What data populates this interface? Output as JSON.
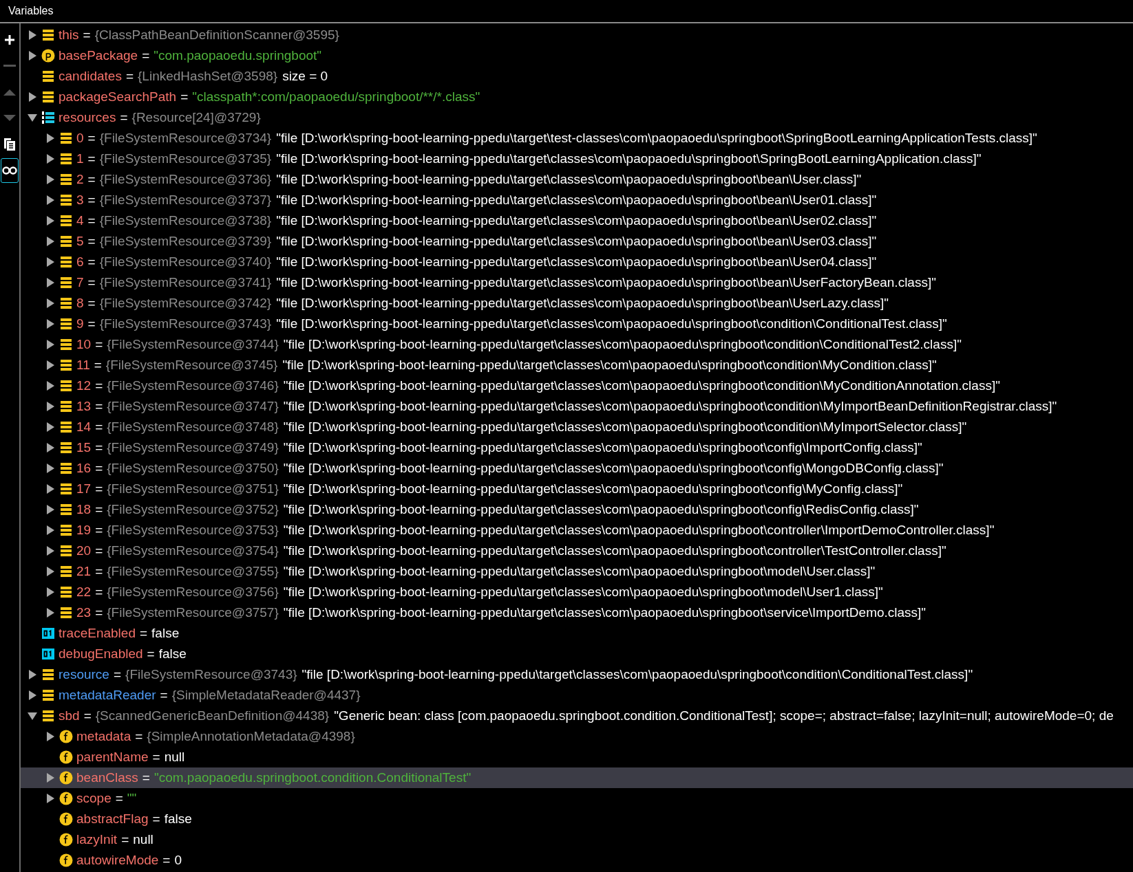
{
  "panel": {
    "title": "Variables"
  },
  "toolbar": [
    {
      "kind": "add",
      "on": false
    },
    {
      "kind": "remove",
      "on": false
    },
    {
      "kind": "up",
      "on": false
    },
    {
      "kind": "down",
      "on": false
    },
    {
      "kind": "copy",
      "on": false
    },
    {
      "kind": "watch",
      "on": true
    }
  ],
  "variables": [
    {
      "name": "this",
      "color": "#f4726a",
      "kind": "object",
      "expanded": false,
      "selected": false,
      "eq": "=",
      "value": [
        {
          "kind": "ref",
          "text": "{ClassPathBeanDefinitionScanner@3595}"
        }
      ]
    },
    {
      "name": "basePackage",
      "color": "#f4726a",
      "kind": "param",
      "expanded": false,
      "selected": false,
      "eq": "=",
      "value": [
        {
          "kind": "string",
          "text": "\"com.paopaoedu.springboot\""
        }
      ]
    },
    {
      "name": "candidates",
      "color": "#f4726a",
      "kind": "object",
      "selected": false,
      "eq": "=",
      "value": [
        {
          "kind": "ref",
          "text": "{LinkedHashSet@3598}"
        },
        {
          "kind": "text",
          "text": "size = 0"
        }
      ]
    },
    {
      "name": "packageSearchPath",
      "color": "#f4726a",
      "kind": "object",
      "expanded": false,
      "selected": false,
      "eq": "=",
      "value": [
        {
          "kind": "string",
          "text": "\"classpath*:com/paopaoedu/springboot/**/*.class\""
        }
      ]
    },
    {
      "name": "resources",
      "color": "#f4726a",
      "kind": "array",
      "expanded": true,
      "selected": false,
      "eq": "=",
      "value": [
        {
          "kind": "ref",
          "text": "{Resource[24]@3729}"
        }
      ],
      "children": [
        {
          "name": "0",
          "color": "#f4726a",
          "kind": "object",
          "expanded": false,
          "selected": false,
          "eq": "=",
          "value": [
            {
              "kind": "ref",
              "text": "{FileSystemResource@3734}"
            },
            {
              "kind": "text",
              "text": "\"file [D:\\work\\spring-boot-learning-ppedu\\target\\test-classes\\com\\paopaoedu\\springboot\\SpringBootLearningApplicationTests.class]\""
            }
          ]
        },
        {
          "name": "1",
          "color": "#f4726a",
          "kind": "object",
          "expanded": false,
          "selected": false,
          "eq": "=",
          "value": [
            {
              "kind": "ref",
              "text": "{FileSystemResource@3735}"
            },
            {
              "kind": "text",
              "text": "\"file [D:\\work\\spring-boot-learning-ppedu\\target\\classes\\com\\paopaoedu\\springboot\\SpringBootLearningApplication.class]\""
            }
          ]
        },
        {
          "name": "2",
          "color": "#f4726a",
          "kind": "object",
          "expanded": false,
          "selected": false,
          "eq": "=",
          "value": [
            {
              "kind": "ref",
              "text": "{FileSystemResource@3736}"
            },
            {
              "kind": "text",
              "text": "\"file [D:\\work\\spring-boot-learning-ppedu\\target\\classes\\com\\paopaoedu\\springboot\\bean\\User.class]\""
            }
          ]
        },
        {
          "name": "3",
          "color": "#f4726a",
          "kind": "object",
          "expanded": false,
          "selected": false,
          "eq": "=",
          "value": [
            {
              "kind": "ref",
              "text": "{FileSystemResource@3737}"
            },
            {
              "kind": "text",
              "text": "\"file [D:\\work\\spring-boot-learning-ppedu\\target\\classes\\com\\paopaoedu\\springboot\\bean\\User01.class]\""
            }
          ]
        },
        {
          "name": "4",
          "color": "#f4726a",
          "kind": "object",
          "expanded": false,
          "selected": false,
          "eq": "=",
          "value": [
            {
              "kind": "ref",
              "text": "{FileSystemResource@3738}"
            },
            {
              "kind": "text",
              "text": "\"file [D:\\work\\spring-boot-learning-ppedu\\target\\classes\\com\\paopaoedu\\springboot\\bean\\User02.class]\""
            }
          ]
        },
        {
          "name": "5",
          "color": "#f4726a",
          "kind": "object",
          "expanded": false,
          "selected": false,
          "eq": "=",
          "value": [
            {
              "kind": "ref",
              "text": "{FileSystemResource@3739}"
            },
            {
              "kind": "text",
              "text": "\"file [D:\\work\\spring-boot-learning-ppedu\\target\\classes\\com\\paopaoedu\\springboot\\bean\\User03.class]\""
            }
          ]
        },
        {
          "name": "6",
          "color": "#f4726a",
          "kind": "object",
          "expanded": false,
          "selected": false,
          "eq": "=",
          "value": [
            {
              "kind": "ref",
              "text": "{FileSystemResource@3740}"
            },
            {
              "kind": "text",
              "text": "\"file [D:\\work\\spring-boot-learning-ppedu\\target\\classes\\com\\paopaoedu\\springboot\\bean\\User04.class]\""
            }
          ]
        },
        {
          "name": "7",
          "color": "#f4726a",
          "kind": "object",
          "expanded": false,
          "selected": false,
          "eq": "=",
          "value": [
            {
              "kind": "ref",
              "text": "{FileSystemResource@3741}"
            },
            {
              "kind": "text",
              "text": "\"file [D:\\work\\spring-boot-learning-ppedu\\target\\classes\\com\\paopaoedu\\springboot\\bean\\UserFactoryBean.class]\""
            }
          ]
        },
        {
          "name": "8",
          "color": "#f4726a",
          "kind": "object",
          "expanded": false,
          "selected": false,
          "eq": "=",
          "value": [
            {
              "kind": "ref",
              "text": "{FileSystemResource@3742}"
            },
            {
              "kind": "text",
              "text": "\"file [D:\\work\\spring-boot-learning-ppedu\\target\\classes\\com\\paopaoedu\\springboot\\bean\\UserLazy.class]\""
            }
          ]
        },
        {
          "name": "9",
          "color": "#f4726a",
          "kind": "object",
          "expanded": false,
          "selected": false,
          "eq": "=",
          "value": [
            {
              "kind": "ref",
              "text": "{FileSystemResource@3743}"
            },
            {
              "kind": "text",
              "text": "\"file [D:\\work\\spring-boot-learning-ppedu\\target\\classes\\com\\paopaoedu\\springboot\\condition\\ConditionalTest.class]\""
            }
          ]
        },
        {
          "name": "10",
          "color": "#f4726a",
          "kind": "object",
          "expanded": false,
          "selected": false,
          "eq": "=",
          "value": [
            {
              "kind": "ref",
              "text": "{FileSystemResource@3744}"
            },
            {
              "kind": "text",
              "text": "\"file [D:\\work\\spring-boot-learning-ppedu\\target\\classes\\com\\paopaoedu\\springboot\\condition\\ConditionalTest2.class]\""
            }
          ]
        },
        {
          "name": "11",
          "color": "#f4726a",
          "kind": "object",
          "expanded": false,
          "selected": false,
          "eq": "=",
          "value": [
            {
              "kind": "ref",
              "text": "{FileSystemResource@3745}"
            },
            {
              "kind": "text",
              "text": "\"file [D:\\work\\spring-boot-learning-ppedu\\target\\classes\\com\\paopaoedu\\springboot\\condition\\MyCondition.class]\""
            }
          ]
        },
        {
          "name": "12",
          "color": "#f4726a",
          "kind": "object",
          "expanded": false,
          "selected": false,
          "eq": "=",
          "value": [
            {
              "kind": "ref",
              "text": "{FileSystemResource@3746}"
            },
            {
              "kind": "text",
              "text": "\"file [D:\\work\\spring-boot-learning-ppedu\\target\\classes\\com\\paopaoedu\\springboot\\condition\\MyConditionAnnotation.class]\""
            }
          ]
        },
        {
          "name": "13",
          "color": "#f4726a",
          "kind": "object",
          "expanded": false,
          "selected": false,
          "eq": "=",
          "value": [
            {
              "kind": "ref",
              "text": "{FileSystemResource@3747}"
            },
            {
              "kind": "text",
              "text": "\"file [D:\\work\\spring-boot-learning-ppedu\\target\\classes\\com\\paopaoedu\\springboot\\condition\\MyImportBeanDefinitionRegistrar.class]\""
            }
          ]
        },
        {
          "name": "14",
          "color": "#f4726a",
          "kind": "object",
          "expanded": false,
          "selected": false,
          "eq": "=",
          "value": [
            {
              "kind": "ref",
              "text": "{FileSystemResource@3748}"
            },
            {
              "kind": "text",
              "text": "\"file [D:\\work\\spring-boot-learning-ppedu\\target\\classes\\com\\paopaoedu\\springboot\\condition\\MyImportSelector.class]\""
            }
          ]
        },
        {
          "name": "15",
          "color": "#f4726a",
          "kind": "object",
          "expanded": false,
          "selected": false,
          "eq": "=",
          "value": [
            {
              "kind": "ref",
              "text": "{FileSystemResource@3749}"
            },
            {
              "kind": "text",
              "text": "\"file [D:\\work\\spring-boot-learning-ppedu\\target\\classes\\com\\paopaoedu\\springboot\\config\\ImportConfig.class]\""
            }
          ]
        },
        {
          "name": "16",
          "color": "#f4726a",
          "kind": "object",
          "expanded": false,
          "selected": false,
          "eq": "=",
          "value": [
            {
              "kind": "ref",
              "text": "{FileSystemResource@3750}"
            },
            {
              "kind": "text",
              "text": "\"file [D:\\work\\spring-boot-learning-ppedu\\target\\classes\\com\\paopaoedu\\springboot\\config\\MongoDBConfig.class]\""
            }
          ]
        },
        {
          "name": "17",
          "color": "#f4726a",
          "kind": "object",
          "expanded": false,
          "selected": false,
          "eq": "=",
          "value": [
            {
              "kind": "ref",
              "text": "{FileSystemResource@3751}"
            },
            {
              "kind": "text",
              "text": "\"file [D:\\work\\spring-boot-learning-ppedu\\target\\classes\\com\\paopaoedu\\springboot\\config\\MyConfig.class]\""
            }
          ]
        },
        {
          "name": "18",
          "color": "#f4726a",
          "kind": "object",
          "expanded": false,
          "selected": false,
          "eq": "=",
          "value": [
            {
              "kind": "ref",
              "text": "{FileSystemResource@3752}"
            },
            {
              "kind": "text",
              "text": "\"file [D:\\work\\spring-boot-learning-ppedu\\target\\classes\\com\\paopaoedu\\springboot\\config\\RedisConfig.class]\""
            }
          ]
        },
        {
          "name": "19",
          "color": "#f4726a",
          "kind": "object",
          "expanded": false,
          "selected": false,
          "eq": "=",
          "value": [
            {
              "kind": "ref",
              "text": "{FileSystemResource@3753}"
            },
            {
              "kind": "text",
              "text": "\"file [D:\\work\\spring-boot-learning-ppedu\\target\\classes\\com\\paopaoedu\\springboot\\controller\\ImportDemoController.class]\""
            }
          ]
        },
        {
          "name": "20",
          "color": "#f4726a",
          "kind": "object",
          "expanded": false,
          "selected": false,
          "eq": "=",
          "value": [
            {
              "kind": "ref",
              "text": "{FileSystemResource@3754}"
            },
            {
              "kind": "text",
              "text": "\"file [D:\\work\\spring-boot-learning-ppedu\\target\\classes\\com\\paopaoedu\\springboot\\controller\\TestController.class]\""
            }
          ]
        },
        {
          "name": "21",
          "color": "#f4726a",
          "kind": "object",
          "expanded": false,
          "selected": false,
          "eq": "=",
          "value": [
            {
              "kind": "ref",
              "text": "{FileSystemResource@3755}"
            },
            {
              "kind": "text",
              "text": "\"file [D:\\work\\spring-boot-learning-ppedu\\target\\classes\\com\\paopaoedu\\springboot\\model\\User.class]\""
            }
          ]
        },
        {
          "name": "22",
          "color": "#f4726a",
          "kind": "object",
          "expanded": false,
          "selected": false,
          "eq": "=",
          "value": [
            {
              "kind": "ref",
              "text": "{FileSystemResource@3756}"
            },
            {
              "kind": "text",
              "text": "\"file [D:\\work\\spring-boot-learning-ppedu\\target\\classes\\com\\paopaoedu\\springboot\\model\\User1.class]\""
            }
          ]
        },
        {
          "name": "23",
          "color": "#f4726a",
          "kind": "object",
          "expanded": false,
          "selected": false,
          "eq": "=",
          "value": [
            {
              "kind": "ref",
              "text": "{FileSystemResource@3757}"
            },
            {
              "kind": "text",
              "text": "\"file [D:\\work\\spring-boot-learning-ppedu\\target\\classes\\com\\paopaoedu\\springboot\\service\\ImportDemo.class]\""
            }
          ]
        }
      ]
    },
    {
      "name": "traceEnabled",
      "color": "#f4726a",
      "kind": "primitive",
      "selected": false,
      "eq": "=",
      "value": [
        {
          "kind": "text",
          "text": "false"
        }
      ]
    },
    {
      "name": "debugEnabled",
      "color": "#f4726a",
      "kind": "primitive",
      "selected": false,
      "eq": "=",
      "value": [
        {
          "kind": "text",
          "text": "false"
        }
      ]
    },
    {
      "name": "resource",
      "color": "#4f9cf5",
      "kind": "object",
      "expanded": false,
      "selected": false,
      "eq": "=",
      "value": [
        {
          "kind": "ref",
          "text": "{FileSystemResource@3743}"
        },
        {
          "kind": "text",
          "text": "\"file [D:\\work\\spring-boot-learning-ppedu\\target\\classes\\com\\paopaoedu\\springboot\\condition\\ConditionalTest.class]\""
        }
      ]
    },
    {
      "name": "metadataReader",
      "color": "#4f9cf5",
      "kind": "object",
      "expanded": false,
      "selected": false,
      "eq": "=",
      "value": [
        {
          "kind": "ref",
          "text": "{SimpleMetadataReader@4437}"
        }
      ]
    },
    {
      "name": "sbd",
      "color": "#f4726a",
      "kind": "object",
      "expanded": true,
      "selected": false,
      "eq": "=",
      "value": [
        {
          "kind": "ref",
          "text": "{ScannedGenericBeanDefinition@4438}"
        },
        {
          "kind": "text",
          "text": "\"Generic bean: class [com.paopaoedu.springboot.condition.ConditionalTest]; scope=; abstract=false; lazyInit=null; autowireMode=0; de"
        }
      ],
      "children": [
        {
          "name": "metadata",
          "color": "#f4726a",
          "kind": "field",
          "expanded": false,
          "selected": false,
          "eq": "=",
          "value": [
            {
              "kind": "ref",
              "text": "{SimpleAnnotationMetadata@4398}"
            }
          ]
        },
        {
          "name": "parentName",
          "color": "#f4726a",
          "kind": "field",
          "selected": false,
          "eq": "=",
          "value": [
            {
              "kind": "text",
              "text": "null"
            }
          ]
        },
        {
          "name": "beanClass",
          "color": "#f4726a",
          "kind": "field",
          "expanded": false,
          "selected": true,
          "eq": "=",
          "value": [
            {
              "kind": "string",
              "text": "\"com.paopaoedu.springboot.condition.ConditionalTest\""
            }
          ]
        },
        {
          "name": "scope",
          "color": "#f4726a",
          "kind": "field",
          "expanded": false,
          "selected": false,
          "eq": "=",
          "value": [
            {
              "kind": "string",
              "text": "\"\""
            }
          ]
        },
        {
          "name": "abstractFlag",
          "color": "#f4726a",
          "kind": "field",
          "selected": false,
          "eq": "=",
          "value": [
            {
              "kind": "text",
              "text": "false"
            }
          ]
        },
        {
          "name": "lazyInit",
          "color": "#f4726a",
          "kind": "field",
          "selected": false,
          "eq": "=",
          "value": [
            {
              "kind": "text",
              "text": "null"
            }
          ]
        },
        {
          "name": "autowireMode",
          "color": "#f4726a",
          "kind": "field",
          "selected": false,
          "eq": "=",
          "value": [
            {
              "kind": "text",
              "text": "0"
            }
          ]
        }
      ]
    }
  ]
}
